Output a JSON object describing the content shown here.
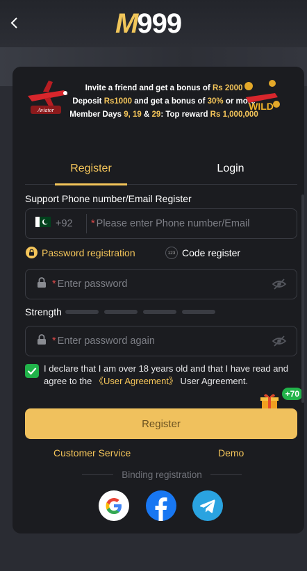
{
  "header": {
    "logo_m": "M",
    "logo_nums": "999"
  },
  "banner": {
    "line1_a": "Invite a friend and get a bonus of ",
    "line1_b": "Rs 2000",
    "line2_a": "Deposit ",
    "line2_b": "Rs1000",
    "line2_c": " and get a bonus of ",
    "line2_d": "30%",
    "line2_e": " or more",
    "line3_a": "Member Days ",
    "line3_b": "9, 19",
    "line3_c": " & ",
    "line3_d": "29",
    "line3_e": ": Top reward ",
    "line3_f": "Rs 1,000,000",
    "plane_label": "Aviator",
    "wild_label": "WILD"
  },
  "tabs": {
    "register": "Register",
    "login": "Login"
  },
  "form": {
    "support_label": "Support Phone number/Email Register",
    "country_code": "+92",
    "phone_placeholder": "Please enter Phone number/Email",
    "required_mark": "*",
    "password_registration": "Password registration",
    "code_register": "Code register",
    "code_icon_text": "123",
    "password_placeholder": "Enter password",
    "strength_label": "Strength",
    "password_again_placeholder": "Enter password again",
    "declare_text": "I declare that I am over 18 years old and that I have read and agree to the ",
    "agreement_link": "《User Agreement》",
    "declare_tail": " User Agreement.",
    "register_button": "Register",
    "gift_bonus": "+70"
  },
  "links": {
    "customer_service": "Customer Service",
    "demo": "Demo"
  },
  "binding": {
    "label": "Binding registration"
  },
  "colors": {
    "accent": "#f4c55a",
    "button": "#f0c15d",
    "panel": "#1b1c20",
    "check": "#21b34a"
  }
}
